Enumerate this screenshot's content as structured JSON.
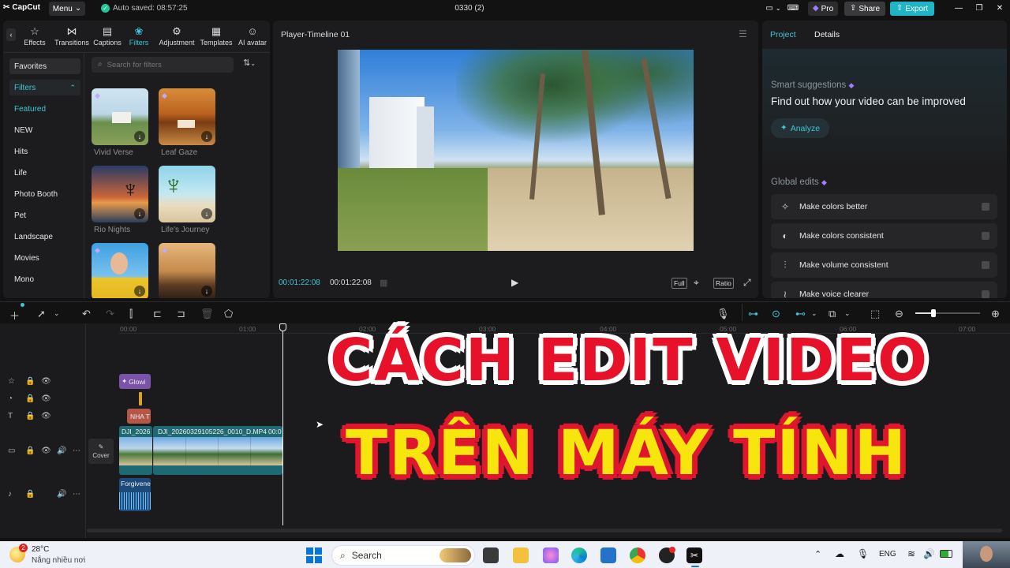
{
  "titlebar": {
    "app_name": "CapCut",
    "menu_label": "Menu",
    "autosave": "Auto saved: 08:57:25",
    "project_title": "0330 (2)",
    "pro_label": "Pro",
    "share_label": "Share",
    "export_label": "Export"
  },
  "toolbar_tabs": [
    "Effects",
    "Transitions",
    "Captions",
    "Filters",
    "Adjustment",
    "Templates",
    "AI avatar"
  ],
  "active_tab": "Filters",
  "filters": {
    "search_placeholder": "Search for filters",
    "categories": [
      "Favorites",
      "Filters",
      "Featured",
      "NEW",
      "Hits",
      "Life",
      "Photo Booth",
      "Pet",
      "Landscape",
      "Movies",
      "Mono"
    ],
    "items": [
      "Vivid Verse",
      "Leaf Gaze",
      "Rio Nights",
      "Life's Journey"
    ]
  },
  "player": {
    "title": "Player-Timeline 01",
    "current_time": "00:01:22:08",
    "total_time": "00:01:22:08",
    "full_label": "Full",
    "ratio_label": "Ratio"
  },
  "right_panel": {
    "tab_project": "Project",
    "tab_details": "Details",
    "smart_title": "Smart suggestions",
    "smart_subtitle": "Find out how your video can be improved",
    "analyze_label": "Analyze",
    "global_title": "Global edits",
    "global_items": [
      "Make colors better",
      "Make colors consistent",
      "Make volume consistent",
      "Make voice clearer"
    ]
  },
  "timeline": {
    "ticks": [
      "00:00",
      "01:00",
      "02:00",
      "03:00",
      "04:00",
      "05:00",
      "06:00",
      "07:00"
    ],
    "effect_clip": "Glowi",
    "text_clip": "NHA T",
    "video_clip_a": "DJI_2026",
    "video_clip_b": "DJI_20260329105226_0010_D.MP4",
    "video_clip_b_dur": "00:0",
    "audio_clip": "Forgivene",
    "cover_label": "Cover"
  },
  "overlay": {
    "line1": "CÁCH EDIT VIDEO",
    "line2": "TRÊN MÁY TÍNH"
  },
  "taskbar": {
    "badge": "2",
    "temperature": "28°C",
    "weather": "Nắng nhiều nơi",
    "search_label": "Search",
    "lang": "ENG"
  },
  "colors": {
    "accent": "#3ec6d6",
    "export": "#1fb5c4",
    "pro": "#a37cff"
  }
}
